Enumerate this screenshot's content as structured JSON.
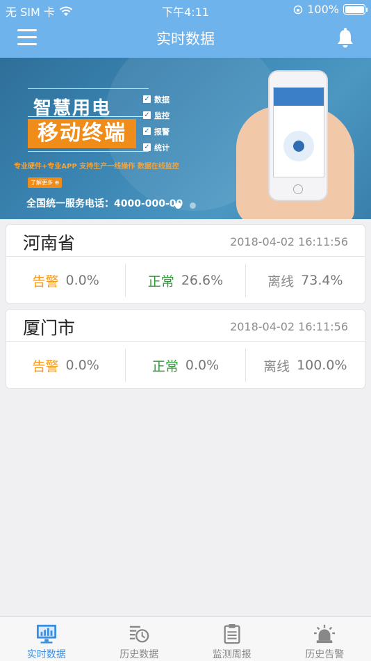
{
  "status_bar": {
    "carrier": "无 SIM 卡",
    "time": "下午4:11",
    "battery": "100%"
  },
  "nav": {
    "title": "实时数据"
  },
  "banner": {
    "title1": "智慧用电",
    "title2": "移动终端",
    "checks": [
      "数据",
      "监控",
      "报警",
      "统计"
    ],
    "tagline": "专业硬件+专业APP    支持生产一线操作    数据在线监控",
    "more": "了解更多 ⊕",
    "phone": "全国统一服务电话：4000-000-00",
    "active_slide": 1,
    "slide_count": 2
  },
  "regions": [
    {
      "name": "河南省",
      "time": "2018-04-02 16:11:56",
      "alarm_label": "告警",
      "alarm_value": "0.0%",
      "normal_label": "正常",
      "normal_value": "26.6%",
      "offline_label": "离线",
      "offline_value": "73.4%"
    },
    {
      "name": "厦门市",
      "time": "2018-04-02 16:11:56",
      "alarm_label": "告警",
      "alarm_value": "0.0%",
      "normal_label": "正常",
      "normal_value": "0.0%",
      "offline_label": "离线",
      "offline_value": "100.0%"
    }
  ],
  "tabs": [
    {
      "label": "实时数据",
      "icon": "monitor-chart-icon",
      "active": true
    },
    {
      "label": "历史数据",
      "icon": "history-clock-icon",
      "active": false
    },
    {
      "label": "监测周报",
      "icon": "clipboard-report-icon",
      "active": false
    },
    {
      "label": "历史告警",
      "icon": "alarm-siren-icon",
      "active": false
    }
  ],
  "colors": {
    "header": "#6fb3ec",
    "alarm": "#f29a21",
    "normal": "#2b9b33",
    "offline": "#888888",
    "tab_active": "#3a8ee0"
  }
}
